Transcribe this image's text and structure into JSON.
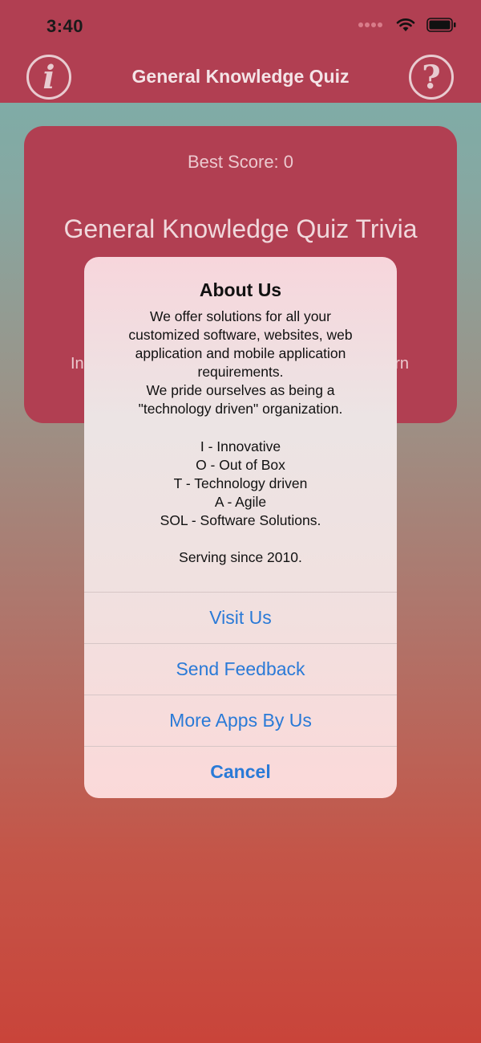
{
  "status_bar": {
    "time": "3:40"
  },
  "nav": {
    "title": "General Knowledge Quiz",
    "info_button": "i",
    "help_button": "?"
  },
  "card": {
    "best_score": "Best Score: 0",
    "title": "General Knowledge Quiz Trivia",
    "partial_left": "In",
    "partial_right": "rn"
  },
  "alert": {
    "title": "About Us",
    "message": "We offer solutions for all your\ncustomized software, websites, web\napplication and mobile application\nrequirements.\nWe pride ourselves as being a\n\"technology driven\" organization.\n\nI - Innovative\nO - Out of Box\nT - Technology driven\nA - Agile\nSOL - Software Solutions.\n\nServing since 2010.",
    "actions": {
      "visit": "Visit Us",
      "feedback": "Send Feedback",
      "more_apps": "More Apps By Us",
      "cancel": "Cancel"
    }
  },
  "colors": {
    "header_bg": "#b13f52",
    "alert_button_text": "#2a7ad7"
  }
}
